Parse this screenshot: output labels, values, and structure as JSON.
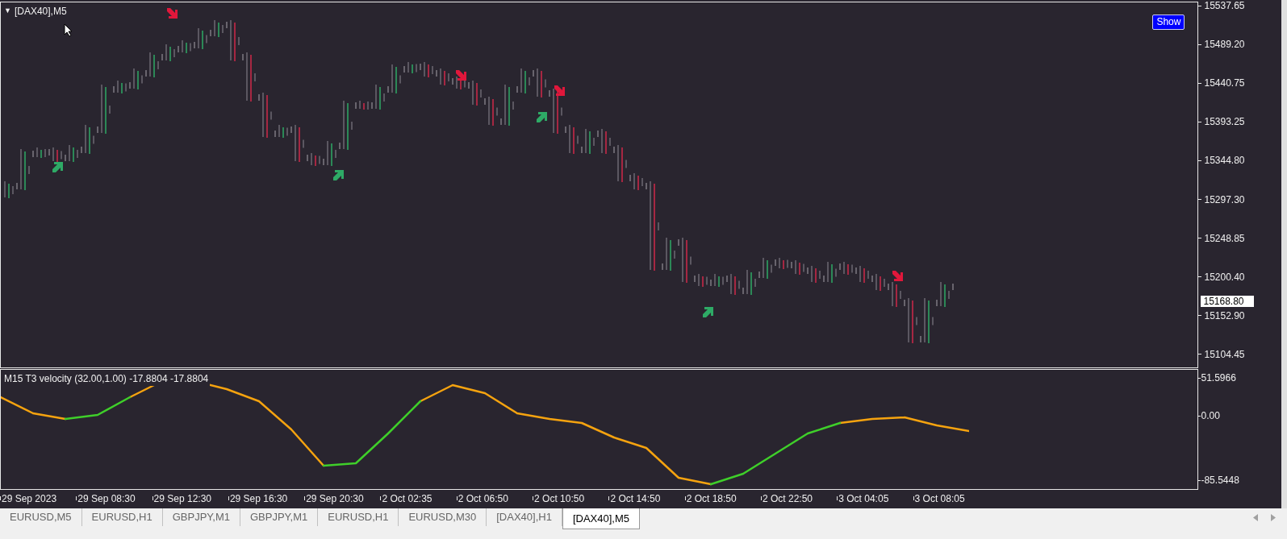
{
  "chart_title": {
    "caret": "▼",
    "text": "[DAX40],M5"
  },
  "show_button": "Show",
  "price_axis": {
    "labels": [
      "15537.65",
      "15489.20",
      "15440.75",
      "15393.25",
      "15344.80",
      "15297.30",
      "15248.85",
      "15200.40",
      "15152.90",
      "15104.45"
    ],
    "current_price": "15168.80"
  },
  "indicator": {
    "label": "M15 T3 velocity (32.00,1.00) -17.8804 -17.8804",
    "axis_labels": [
      "51.5966",
      "0.00",
      "-85.5448"
    ]
  },
  "time_axis": [
    "29 Sep 2023",
    "29 Sep 08:30",
    "29 Sep 12:30",
    "29 Sep 16:30",
    "29 Sep 20:30",
    "2 Oct 02:35",
    "2 Oct 06:50",
    "2 Oct 10:50",
    "2 Oct 14:50",
    "2 Oct 18:50",
    "2 Oct 22:50",
    "3 Oct 04:05",
    "3 Oct 08:05"
  ],
  "tabs": [
    {
      "label": "EURUSD,M5",
      "selected": false
    },
    {
      "label": "EURUSD,H1",
      "selected": false
    },
    {
      "label": "GBPJPY,M1",
      "selected": false
    },
    {
      "label": "GBPJPY,M1",
      "selected": false
    },
    {
      "label": "EURUSD,H1",
      "selected": false
    },
    {
      "label": "EURUSD,M30",
      "selected": false
    },
    {
      "label": "[DAX40],H1",
      "selected": false
    },
    {
      "label": "[DAX40],M5",
      "selected": true
    }
  ]
}
